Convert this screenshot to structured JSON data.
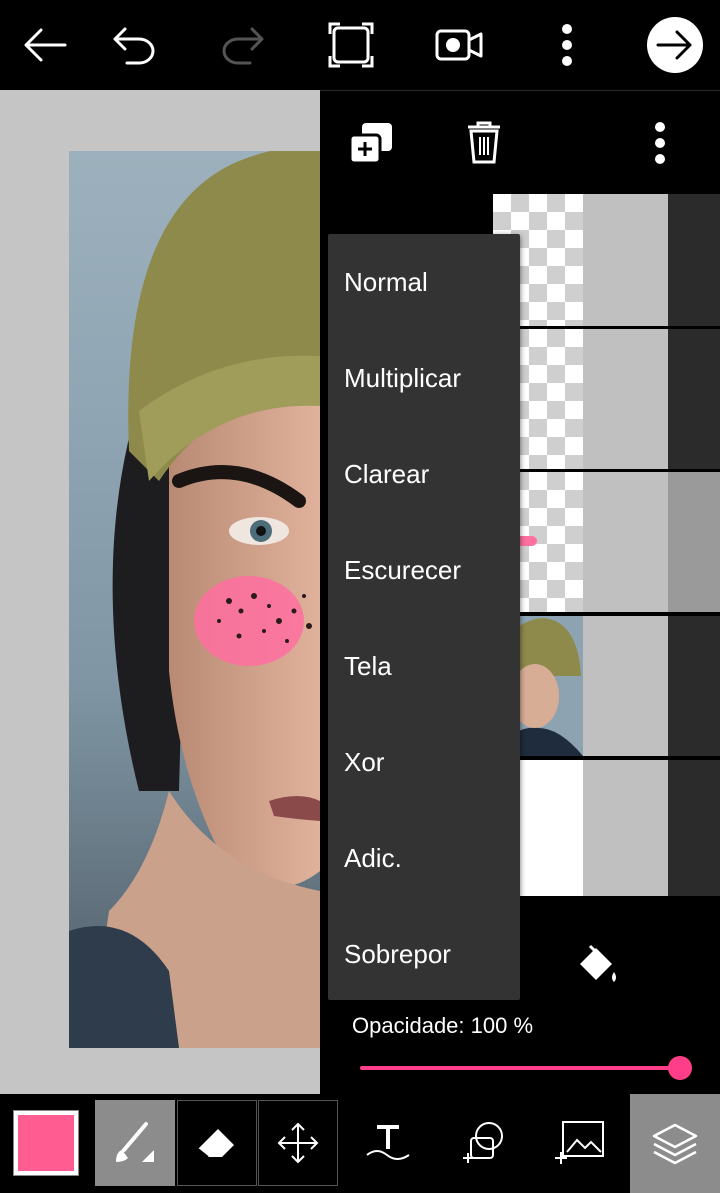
{
  "toolbar": {
    "icons": [
      "back-arrow-icon",
      "undo-icon",
      "redo-icon",
      "crop-frame-icon",
      "video-record-icon",
      "more-vertical-icon",
      "next-arrow-icon"
    ]
  },
  "layers_toolbar": {
    "icons": [
      "add-layer-icon",
      "trash-icon",
      "more-vertical-icon"
    ]
  },
  "blend_menu": {
    "items": [
      "Normal",
      "Multiplicar",
      "Clarear",
      "Escurecer",
      "Tela",
      "Xor",
      "Adic.",
      "Sobrepor"
    ]
  },
  "opacity": {
    "label": "Opacidade: 100 %",
    "value_percent": 100
  },
  "colors": {
    "accent": "#ff3e8a",
    "current_color": "#ff5c92",
    "menu_bg": "#333333",
    "panel_bg": "#000000",
    "canvas_bg": "#c5c5c5"
  },
  "bottom_tools": [
    "color-swatch",
    "brush-icon",
    "eraser-icon",
    "move-icon",
    "text-icon",
    "shape-icon",
    "add-image-icon",
    "layers-icon"
  ]
}
